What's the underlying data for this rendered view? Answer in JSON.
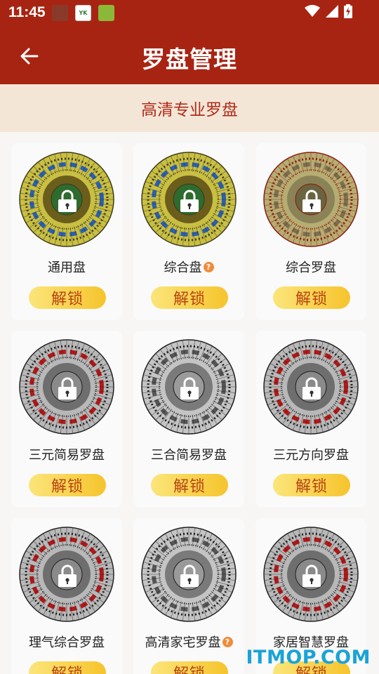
{
  "status_bar": {
    "time": "11:45",
    "notifications": [
      {
        "icon": "app-notification-icon-1",
        "color": "#8a3a2a",
        "label": ""
      },
      {
        "icon": "app-notification-icon-2",
        "color": "#ffffff",
        "label": "YK"
      },
      {
        "icon": "app-notification-icon-3",
        "color": "#8cb83a",
        "label": ""
      }
    ]
  },
  "header": {
    "title": "罗盘管理",
    "background": "#a82412"
  },
  "banner": {
    "text": "高清专业罗盘"
  },
  "compass_cards": [
    {
      "name": "通用盘",
      "has_help": false,
      "button": "解锁",
      "style": "gold"
    },
    {
      "name": "综合盘",
      "has_help": true,
      "button": "解锁",
      "style": "gold"
    },
    {
      "name": "综合罗盘",
      "has_help": false,
      "button": "解锁",
      "style": "khaki"
    },
    {
      "name": "三元简易罗盘",
      "has_help": false,
      "button": "解锁",
      "style": "redgrey"
    },
    {
      "name": "三合简易罗盘",
      "has_help": false,
      "button": "解锁",
      "style": "grey"
    },
    {
      "name": "三元方向罗盘",
      "has_help": false,
      "button": "解锁",
      "style": "redgrey"
    },
    {
      "name": "理气综合罗盘",
      "has_help": false,
      "button": "解锁",
      "style": "redgrey"
    },
    {
      "name": "高清家宅罗盘",
      "has_help": true,
      "button": "解锁",
      "style": "grey"
    },
    {
      "name": "家居智慧罗盘",
      "has_help": false,
      "button": "解锁",
      "style": "redgrey"
    }
  ],
  "help_mark": "?",
  "watermark": "ITMOP.COM"
}
